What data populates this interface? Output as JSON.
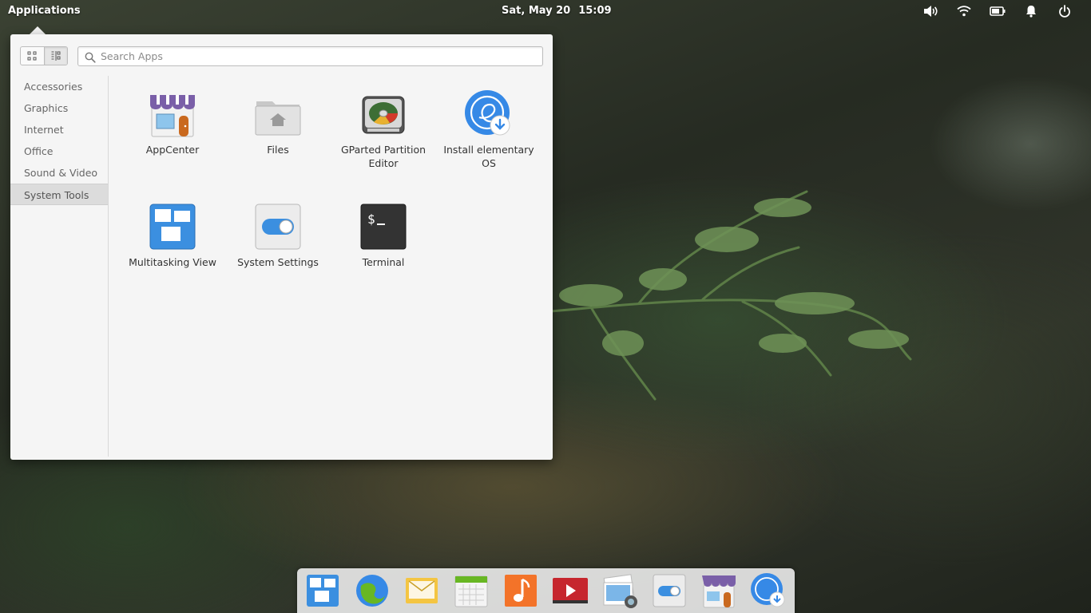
{
  "panel": {
    "applications_label": "Applications",
    "date": "Sat, May 20",
    "time": "15:09",
    "indicators": [
      "volume-icon",
      "wifi-icon",
      "battery-icon",
      "notification-bell-icon",
      "power-icon"
    ]
  },
  "launcher": {
    "search_placeholder": "Search Apps",
    "view_modes": [
      "grid-view-icon",
      "category-view-icon"
    ],
    "categories": [
      {
        "label": "Accessories",
        "selected": false
      },
      {
        "label": "Graphics",
        "selected": false
      },
      {
        "label": "Internet",
        "selected": false
      },
      {
        "label": "Office",
        "selected": false
      },
      {
        "label": "Sound & Video",
        "selected": false
      },
      {
        "label": "System Tools",
        "selected": true
      }
    ],
    "apps": [
      {
        "label": "AppCenter",
        "icon": "appcenter-icon"
      },
      {
        "label": "Files",
        "icon": "files-icon"
      },
      {
        "label": "GParted Partition Editor",
        "icon": "gparted-icon"
      },
      {
        "label": "Install elementary OS",
        "icon": "installer-icon"
      },
      {
        "label": "Multitasking View",
        "icon": "multitasking-view-icon"
      },
      {
        "label": "System Settings",
        "icon": "system-settings-icon"
      },
      {
        "label": "Terminal",
        "icon": "terminal-icon"
      }
    ]
  },
  "dock": {
    "items": [
      "multitasking-view-icon",
      "web-browser-icon",
      "mail-icon",
      "calendar-icon",
      "music-icon",
      "videos-icon",
      "photos-icon",
      "system-settings-icon",
      "appcenter-icon",
      "installer-icon"
    ]
  },
  "colors": {
    "popover_bg": "#f5f5f5",
    "selected_category_bg": "#dcdcdc",
    "accent_blue": "#3689e6",
    "terminal_bg": "#333333"
  }
}
